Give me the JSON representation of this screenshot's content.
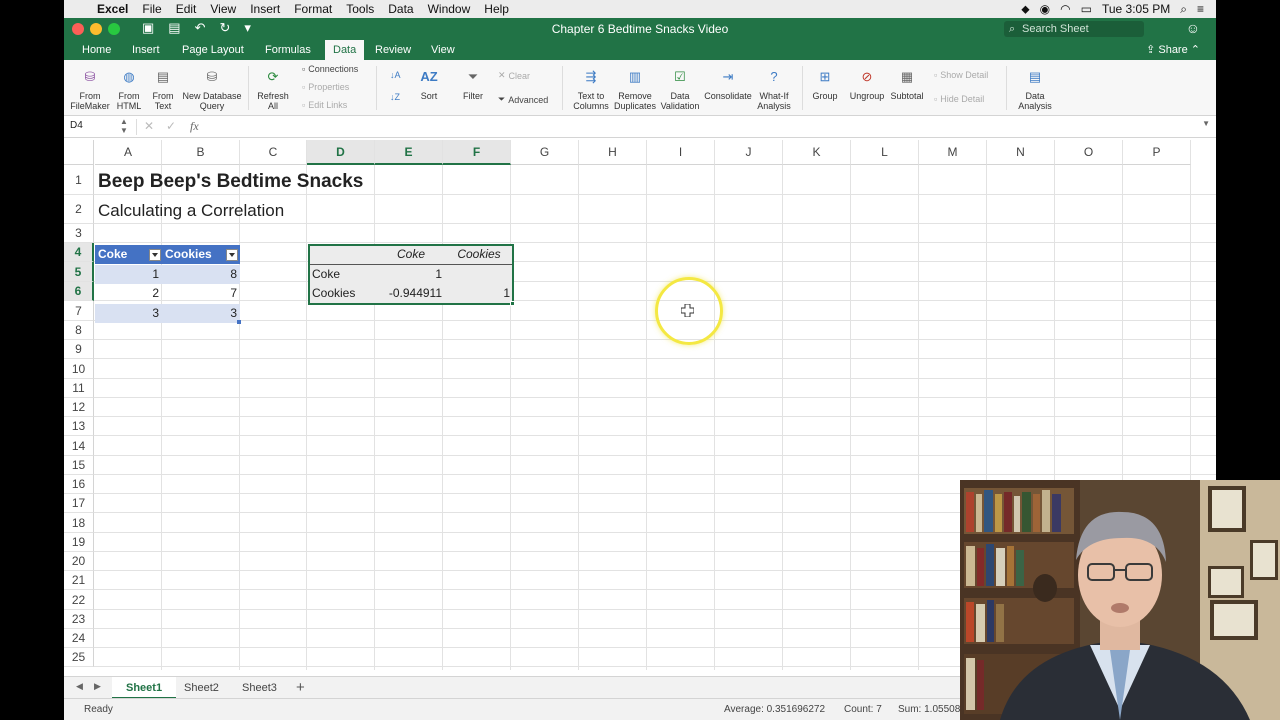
{
  "menubar": {
    "app": "Excel",
    "items": [
      "File",
      "Edit",
      "View",
      "Insert",
      "Format",
      "Tools",
      "Data",
      "Window",
      "Help"
    ],
    "clock": "Tue 3:05 PM"
  },
  "titlebar": {
    "doc_title": "Chapter 6 Bedtime Snacks Video",
    "search_placeholder": "Search Sheet"
  },
  "tabs": [
    "Home",
    "Insert",
    "Page Layout",
    "Formulas",
    "Data",
    "Review",
    "View"
  ],
  "active_tab": "Data",
  "share_label": "Share",
  "ribbon": {
    "from_filemaker": "From\nFileMaker",
    "from_html": "From\nHTML",
    "from_text": "From\nText",
    "new_db_query": "New Database\nQuery",
    "refresh_all": "Refresh\nAll",
    "connections": "Connections",
    "properties": "Properties",
    "edit_links": "Edit Links",
    "sort": "Sort",
    "filter": "Filter",
    "clear": "Clear",
    "advanced": "Advanced",
    "text_to_columns": "Text to\nColumns",
    "remove_duplicates": "Remove\nDuplicates",
    "data_validation": "Data\nValidation",
    "consolidate": "Consolidate",
    "what_if": "What-If\nAnalysis",
    "group": "Group",
    "ungroup": "Ungroup",
    "subtotal": "Subtotal",
    "show_detail": "Show Detail",
    "hide_detail": "Hide Detail",
    "data_analysis": "Data\nAnalysis"
  },
  "formula_bar": {
    "name_box": "D4",
    "fx": "fx",
    "content": ""
  },
  "columns": [
    "A",
    "B",
    "C",
    "D",
    "E",
    "F",
    "G",
    "H",
    "I",
    "J",
    "K",
    "L",
    "M",
    "N",
    "O",
    "P"
  ],
  "rows": [
    "1",
    "2",
    "3",
    "4",
    "5",
    "6",
    "7",
    "8",
    "9",
    "10",
    "11",
    "12",
    "13",
    "14",
    "15",
    "16",
    "17",
    "18",
    "19",
    "20",
    "21",
    "22",
    "23",
    "24",
    "25"
  ],
  "sheet": {
    "title": "Beep Beep's Bedtime Snacks",
    "subtitle": "Calculating a Correlation",
    "table": {
      "headers": [
        "Coke",
        "Cookies"
      ],
      "rows": [
        [
          "1",
          "8"
        ],
        [
          "2",
          "7"
        ],
        [
          "3",
          "3"
        ]
      ]
    },
    "correlation": {
      "col_headers": [
        "Coke",
        "Cookies"
      ],
      "rows": [
        {
          "label": "Coke",
          "values": [
            "1",
            ""
          ]
        },
        {
          "label": "Cookies",
          "values": [
            "-0.944911",
            "1"
          ]
        }
      ]
    }
  },
  "sheet_tabs": [
    "Sheet1",
    "Sheet2",
    "Sheet3"
  ],
  "active_sheet": "Sheet1",
  "status": {
    "ready": "Ready",
    "average": "Average: 0.351696272",
    "count": "Count: 7",
    "sum": "Sum: 1.05508"
  },
  "colors": {
    "excel_green": "#217346",
    "table_blue": "#4472c4",
    "band_blue": "#d9e1f2"
  }
}
